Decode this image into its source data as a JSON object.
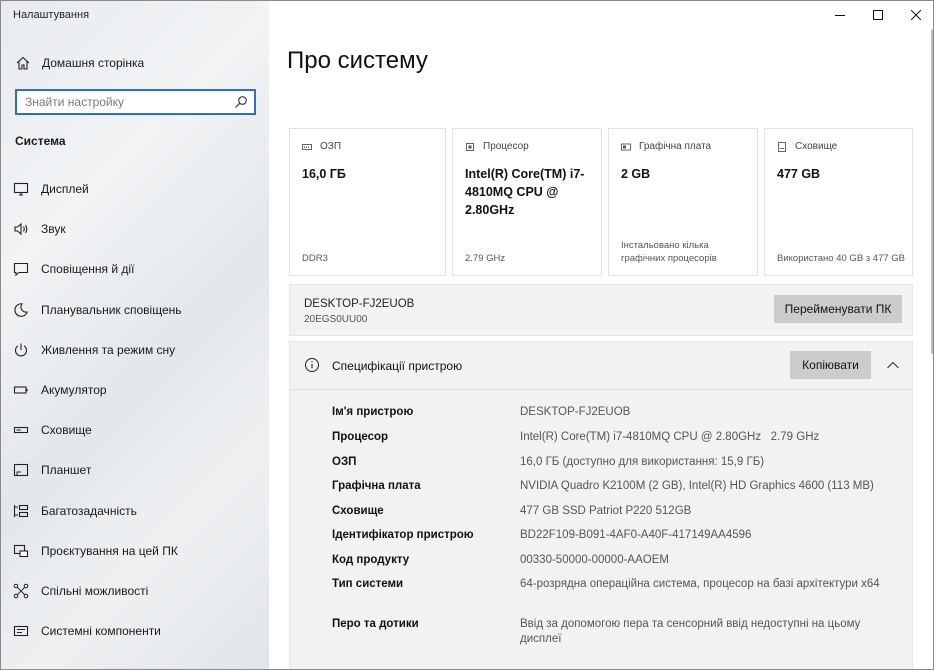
{
  "app": {
    "title": "Налаштування"
  },
  "sidebar": {
    "home_label": "Домашня сторінка",
    "search_placeholder": "Знайти настройку",
    "section_title": "Система",
    "items": [
      {
        "label": "Дисплей",
        "icon": "display-icon"
      },
      {
        "label": "Звук",
        "icon": "sound-icon"
      },
      {
        "label": "Сповіщення й дії",
        "icon": "notifications-icon"
      },
      {
        "label": "Планувальник сповіщень",
        "icon": "moon-icon"
      },
      {
        "label": "Живлення та режим сну",
        "icon": "power-icon"
      },
      {
        "label": "Акумулятор",
        "icon": "battery-icon"
      },
      {
        "label": "Сховище",
        "icon": "storage-icon"
      },
      {
        "label": "Планшет",
        "icon": "tablet-icon"
      },
      {
        "label": "Багатозадачність",
        "icon": "multitasking-icon"
      },
      {
        "label": "Проєктування на цей ПК",
        "icon": "projecting-icon"
      },
      {
        "label": "Спільні можливості",
        "icon": "shared-experiences-icon"
      },
      {
        "label": "Системні компоненти",
        "icon": "components-icon"
      }
    ]
  },
  "main": {
    "title": "Про систему",
    "cards": [
      {
        "label": "ОЗП",
        "value": "16,0 ГБ",
        "footer": "DDR3",
        "icon": "ram-icon"
      },
      {
        "label": "Процесор",
        "value": "Intel(R) Core(TM) i7-4810MQ CPU @ 2.80GHz",
        "footer": "2.79 GHz",
        "icon": "processor-icon"
      },
      {
        "label": "Графічна плата",
        "value": "2 GB",
        "footer": "Інстальовано кілька графічних процесорів",
        "icon": "graphics-icon"
      },
      {
        "label": "Сховище",
        "value": "477 GB",
        "footer": "Використано 40 GB з 477 GB",
        "icon": "storage-icon"
      }
    ],
    "device": {
      "name": "DESKTOP-FJ2EUOB",
      "model": "20EGS0UU00",
      "rename_label": "Перейменувати ПК"
    },
    "specs": {
      "title": "Специфікації пристрою",
      "copy_label": "Копіювати",
      "rows": [
        {
          "key": "Ім'я пристрою",
          "value": "DESKTOP-FJ2EUOB"
        },
        {
          "key": "Процесор",
          "value": "Intel(R) Core(TM) i7-4810MQ CPU @ 2.80GHz   2.79 GHz"
        },
        {
          "key": "ОЗП",
          "value": "16,0 ГБ (доступно для використання: 15,9 ГБ)"
        },
        {
          "key": "Графічна плата",
          "value": "NVIDIA Quadro K2100M (2 GB), Intel(R) HD Graphics 4600 (113 MB)"
        },
        {
          "key": "Сховище",
          "value": "477 GB SSD Patriot P220 512GB"
        },
        {
          "key": "Ідентифікатор пристрою",
          "value": "BD22F109-B091-4AF0-A40F-417149AA4596"
        },
        {
          "key": "Код продукту",
          "value": "00330-50000-00000-AAOEM"
        },
        {
          "key": "Тип системи",
          "value": "64-розрядна операційна система, процесор на базі архітектури x64"
        },
        {
          "key": "Перо та дотики",
          "value": "Ввід за допомогою пера та сенсорний ввід недоступні на цьому дисплеї"
        }
      ]
    }
  },
  "colors": {
    "accent": "#2c6fc4",
    "button": "#cccccc",
    "panel": "#f2f2f2"
  }
}
